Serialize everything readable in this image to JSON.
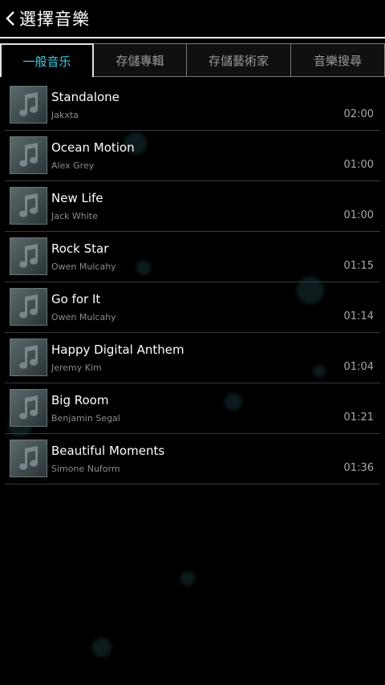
{
  "header": {
    "title": "選擇音樂"
  },
  "tabs": [
    {
      "label": "一般音乐",
      "active": true
    },
    {
      "label": "存儲專輯",
      "active": false
    },
    {
      "label": "存儲藝術家",
      "active": false
    },
    {
      "label": "音樂搜尋",
      "active": false
    }
  ],
  "songs": [
    {
      "title": "Standalone",
      "artist": "Jakxta",
      "duration": "02:00"
    },
    {
      "title": "Ocean Motion",
      "artist": "Alex Grey",
      "duration": "01:00"
    },
    {
      "title": "New Life",
      "artist": "Jack White",
      "duration": "01:00"
    },
    {
      "title": "Rock Star",
      "artist": "Owen Mulcahy",
      "duration": "01:15"
    },
    {
      "title": "Go for It",
      "artist": "Owen Mulcahy",
      "duration": "01:14"
    },
    {
      "title": "Happy Digital Anthem",
      "artist": "Jeremy Kim",
      "duration": "01:04"
    },
    {
      "title": "Big Room",
      "artist": "Benjamin Segal",
      "duration": "01:21"
    },
    {
      "title": "Beautiful Moments",
      "artist": "Simone Nuform",
      "duration": "01:36"
    }
  ],
  "colors": {
    "accent": "#3fc7e0",
    "background": "#000000",
    "divider": "#3a3a3a"
  },
  "icons": {
    "back": "chevron-left-icon",
    "thumbnail": "music-note-icon"
  }
}
